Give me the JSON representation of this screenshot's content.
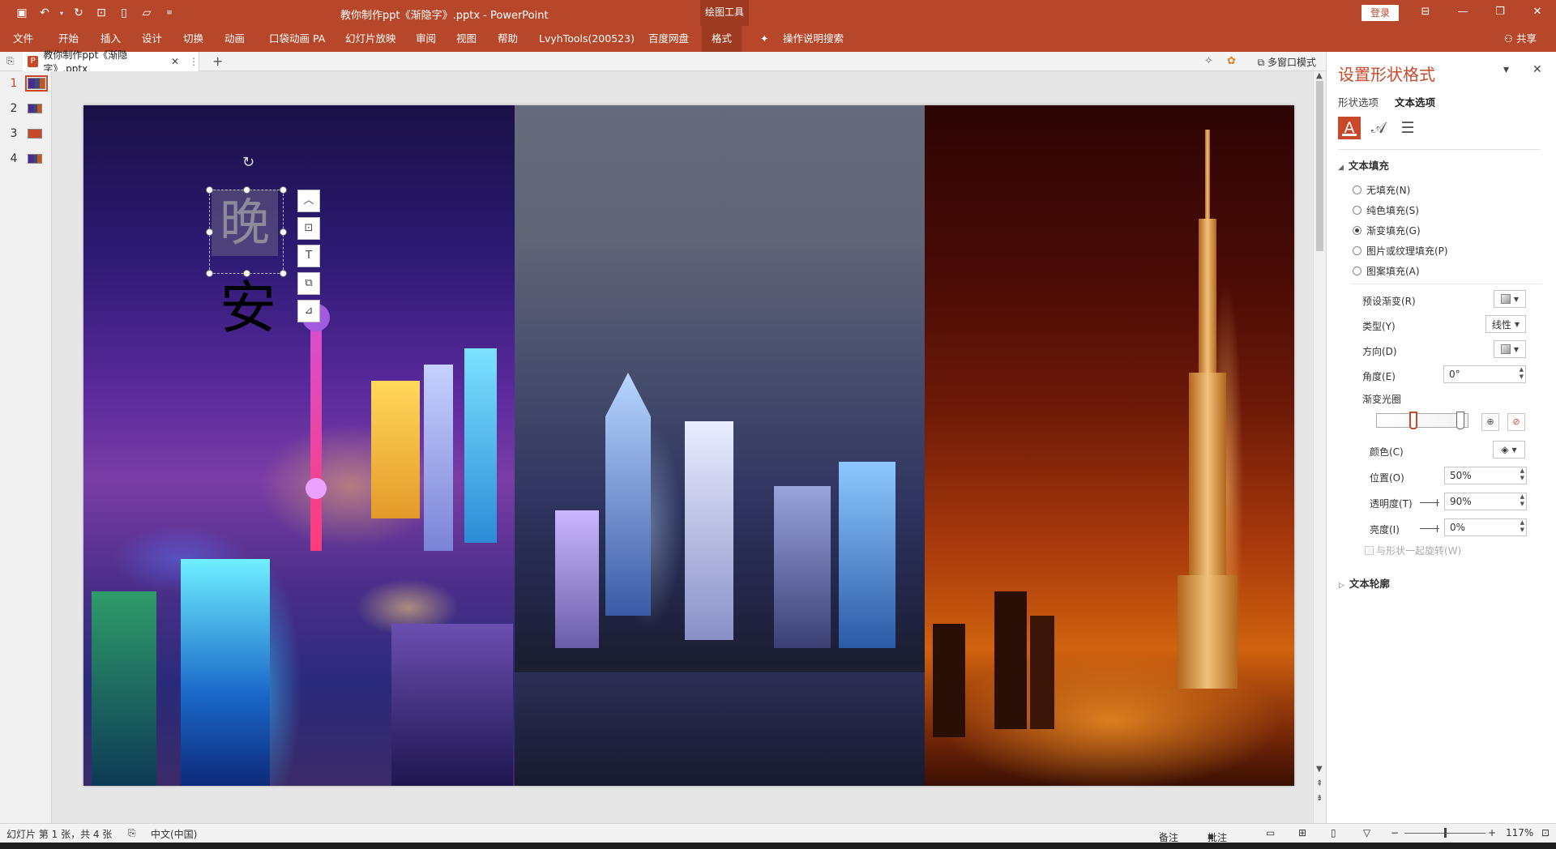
{
  "app": {
    "title": "教你制作ppt《渐隐字》.pptx  -  PowerPoint",
    "context_tools": "绘图工具",
    "login": "登录",
    "share": "共享"
  },
  "ribbon": {
    "tabs": [
      "文件",
      "开始",
      "插入",
      "设计",
      "切换",
      "动画",
      "口袋动画 PA",
      "幻灯片放映",
      "审阅",
      "视图",
      "帮助",
      "LvyhTools(200523)",
      "百度网盘",
      "格式"
    ],
    "active_tab": "格式",
    "search": "操作说明搜索"
  },
  "doc_tab": {
    "name": "教你制作ppt《渐隐字》.pptx",
    "multiwindow": "多窗口模式"
  },
  "thumbnails": [
    "1",
    "2",
    "3",
    "4"
  ],
  "slide": {
    "char1": "晚",
    "char2": "安"
  },
  "pane": {
    "title": "设置形状格式",
    "tabs": [
      "形状选项",
      "文本选项"
    ],
    "active_tab": "文本选项",
    "section_fill": "文本填充",
    "fill_options": [
      "无填充(N)",
      "纯色填充(S)",
      "渐变填充(G)",
      "图片或纹理填充(P)",
      "图案填充(A)"
    ],
    "selected_fill": "渐变填充(G)",
    "preset_label": "预设渐变(R)",
    "type_label": "类型(Y)",
    "type_value": "线性",
    "direction_label": "方向(D)",
    "angle_label": "角度(E)",
    "angle_value": "0°",
    "stops_label": "渐变光圈",
    "color_label": "颜色(C)",
    "position_label": "位置(O)",
    "position_value": "50%",
    "transparency_label": "透明度(T)",
    "transparency_value": "90%",
    "brightness_label": "亮度(I)",
    "brightness_value": "0%",
    "rotate_label": "与形状一起旋转(W)",
    "section_outline": "文本轮廓"
  },
  "status": {
    "slide_info": "幻灯片 第 1 张，共 4 张",
    "language": "中文(中国)",
    "notes": "备注",
    "comments": "批注",
    "zoom": "117%"
  },
  "colors": {
    "accent": "#b7472a",
    "pane_title": "#c9482a"
  }
}
